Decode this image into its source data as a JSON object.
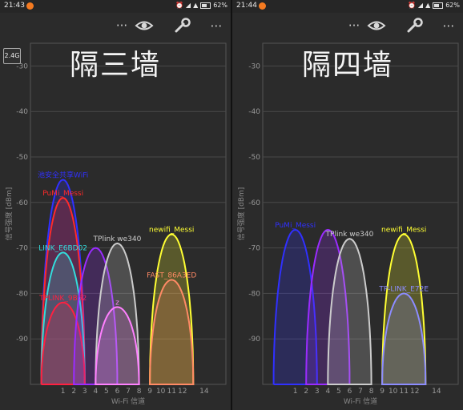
{
  "left": {
    "status": {
      "time": "21:43",
      "battery": "62%"
    },
    "band_label": "2.4G",
    "overlay_title": "隔三墙",
    "chart_data": {
      "type": "area",
      "ylabel": "信号强度 [dBm]",
      "xlabel": "Wi-Fi 信道",
      "x_ticks": [
        1,
        2,
        3,
        4,
        5,
        6,
        7,
        8,
        9,
        10,
        11,
        12,
        14
      ],
      "y_ticks": [
        -30,
        -40,
        -50,
        -60,
        -70,
        -80,
        -90
      ],
      "xlim": [
        -2,
        16
      ],
      "ylim": [
        -100,
        -25
      ],
      "grid": true,
      "series": [
        {
          "name": "池安全共享WiFi",
          "channel": 1,
          "dbm": -55,
          "color": "#3030ff"
        },
        {
          "name": "PuMi_Messi",
          "channel": 1,
          "dbm": -59,
          "color": "#ff2a2a"
        },
        {
          "name": "LINK_E6BD02",
          "channel": 1,
          "dbm": -71,
          "color": "#33dddd"
        },
        {
          "name": "TPLINK_9B62",
          "channel": 1,
          "dbm": -82,
          "color": "#ff2040"
        },
        {
          "name": "",
          "channel": 4,
          "dbm": -70,
          "color": "#9a2cff"
        },
        {
          "name": "TPlink we340",
          "channel": 6,
          "dbm": -69,
          "color": "#cccccc"
        },
        {
          "name": "z",
          "channel": 6,
          "dbm": -83,
          "color": "#ff80ff"
        },
        {
          "name": "newifi_Messi",
          "channel": 11,
          "dbm": -67,
          "color": "#ffff33"
        },
        {
          "name": "FAST_86A3ED",
          "channel": 11,
          "dbm": -77,
          "color": "#ff8a65"
        }
      ]
    }
  },
  "right": {
    "status": {
      "time": "21:44",
      "battery": "62%"
    },
    "overlay_title": "隔四墙",
    "chart_data": {
      "type": "area",
      "ylabel": "信号强度 [dBm]",
      "xlabel": "Wi-Fi 信道",
      "x_ticks": [
        1,
        2,
        3,
        4,
        5,
        6,
        7,
        8,
        9,
        10,
        11,
        12,
        14
      ],
      "y_ticks": [
        -30,
        -40,
        -50,
        -60,
        -70,
        -80,
        -90
      ],
      "xlim": [
        -2,
        16
      ],
      "ylim": [
        -100,
        -25
      ],
      "grid": true,
      "series": [
        {
          "name": "PuMi_Messi",
          "channel": 1,
          "dbm": -66,
          "color": "#3030ff"
        },
        {
          "name": "",
          "channel": 4,
          "dbm": -66,
          "color": "#9a2cff"
        },
        {
          "name": "TPlink we340",
          "channel": 6,
          "dbm": -68,
          "color": "#cccccc"
        },
        {
          "name": "newifi_Messi",
          "channel": 11,
          "dbm": -67,
          "color": "#ffff33"
        },
        {
          "name": "TP-LINK_E72E",
          "channel": 11,
          "dbm": -80,
          "color": "#8c8cff"
        }
      ]
    }
  }
}
